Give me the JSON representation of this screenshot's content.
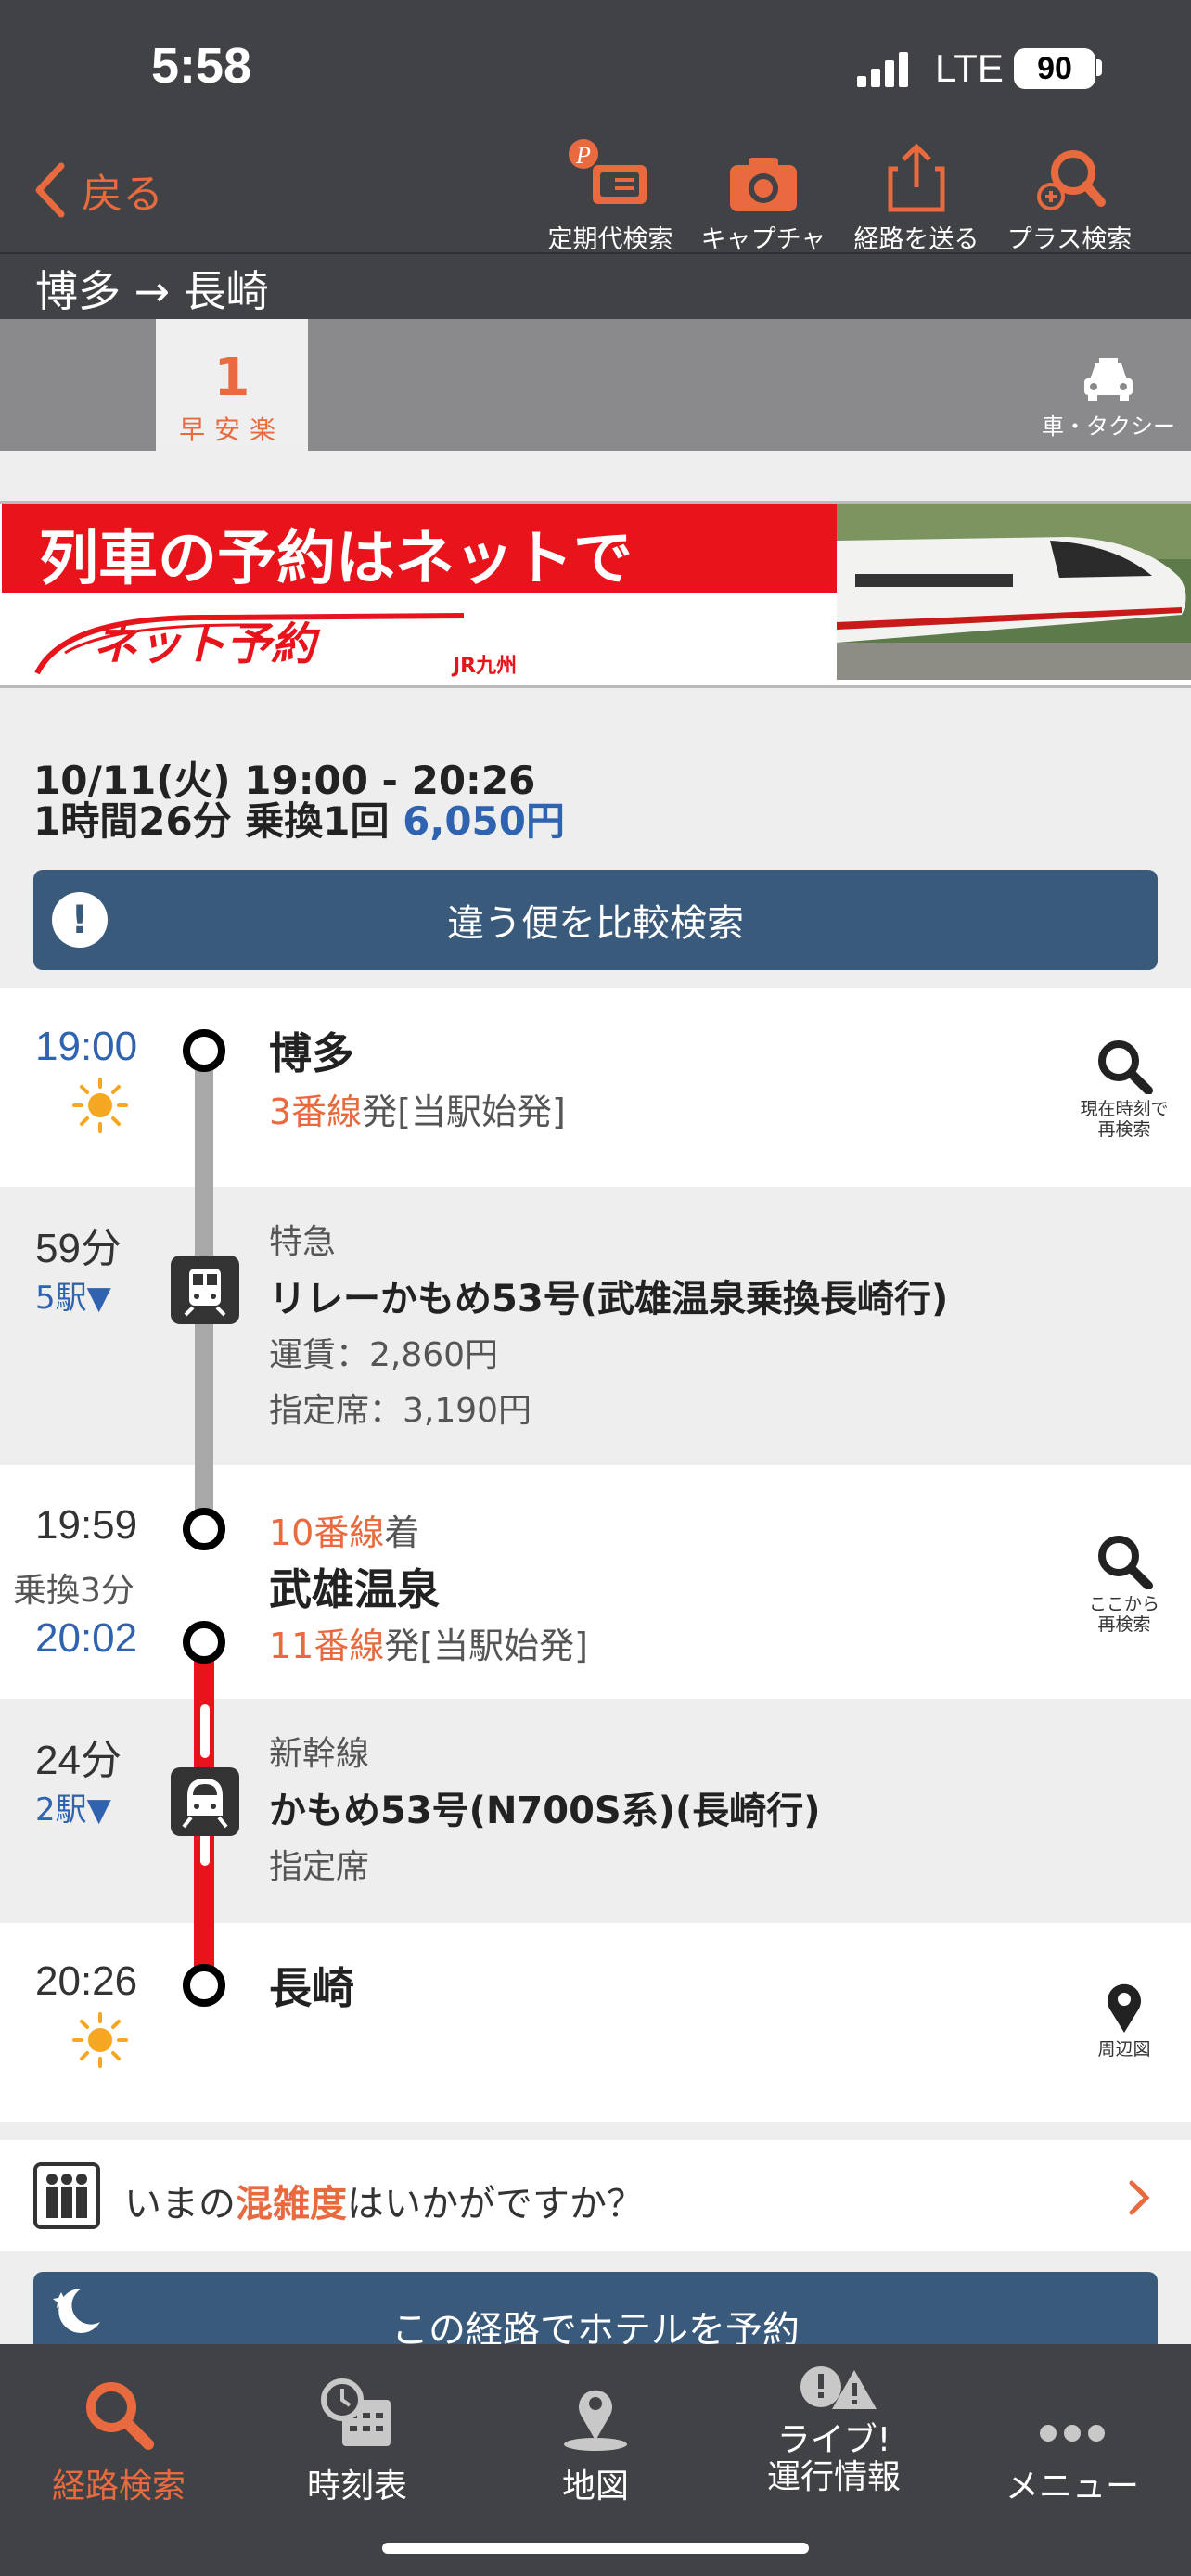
{
  "status_bar": {
    "time": "5:58",
    "network": "LTE",
    "battery": "90"
  },
  "header": {
    "back_label": "戻る",
    "tools": [
      {
        "label": "定期代検索",
        "icon": "commuter-pass-icon",
        "badge": "P"
      },
      {
        "label": "キャプチャ",
        "icon": "camera-icon"
      },
      {
        "label": "経路を送る",
        "icon": "share-icon"
      },
      {
        "label": "プラス検索",
        "icon": "plus-search-icon"
      }
    ],
    "route_title": "博多 → 長崎"
  },
  "tabs": {
    "route_number": "1",
    "route_tags": "早安楽",
    "taxi_label": "車・タクシー"
  },
  "banner": {
    "headline": "列車の予約はネットで",
    "logo_text": "ネット予約",
    "brand": "JR九州"
  },
  "summary": {
    "line1": "10/11(火) 19:00 - 20:26",
    "duration_transfers": "1時間26分 乗換1回 ",
    "fare": "6,050円",
    "compare_button": "違う便を比較検索"
  },
  "route": {
    "stop1": {
      "time": "19:00",
      "name": "博多",
      "platform": "3番線",
      "platform_suffix": "発[当駅始発]",
      "search_label_1": "現在時刻で",
      "search_label_2": "再検索"
    },
    "leg1": {
      "duration": "59分",
      "stops": "5駅▼",
      "type": "特急",
      "train": "リレーかもめ53号(武雄温泉乗換長崎行)",
      "fare": "運賃：2,860円",
      "reserved": "指定席：3,190円"
    },
    "stop2": {
      "arrive_time": "19:59",
      "transfer": "乗換3分",
      "depart_time": "20:02",
      "arrive_platform": "10番線",
      "arrive_suffix": "着",
      "name": "武雄温泉",
      "depart_platform": "11番線",
      "depart_suffix": "発[当駅始発]",
      "search_label_1": "ここから",
      "search_label_2": "再検索"
    },
    "leg2": {
      "duration": "24分",
      "stops": "2駅▼",
      "type": "新幹線",
      "train": "かもめ53号(N700S系)(長崎行)",
      "seat": "指定席"
    },
    "stop3": {
      "time": "20:26",
      "name": "長崎",
      "map_label": "周辺図"
    }
  },
  "congestion": {
    "prefix": "いまの",
    "highlight": "混雑度",
    "suffix": "はいかがですか？"
  },
  "hotel_button": "この経路でホテルを予約",
  "bottom_nav": [
    {
      "label": "経路検索",
      "icon": "route-search-icon",
      "active": true
    },
    {
      "label": "時刻表",
      "icon": "timetable-icon"
    },
    {
      "label": "地図",
      "icon": "map-pin-icon"
    },
    {
      "label": "ライブ!\n運行情報",
      "icon": "live-info-icon"
    },
    {
      "label": "メニュー",
      "icon": "more-icon"
    }
  ],
  "colors": {
    "accent": "#e86a3e",
    "header_bg": "#414246",
    "button_bg": "#3a5a7c",
    "time_blue": "#2f63b0",
    "shinkansen_line": "#e8131b",
    "limited_express_line": "#a8a8a8"
  }
}
